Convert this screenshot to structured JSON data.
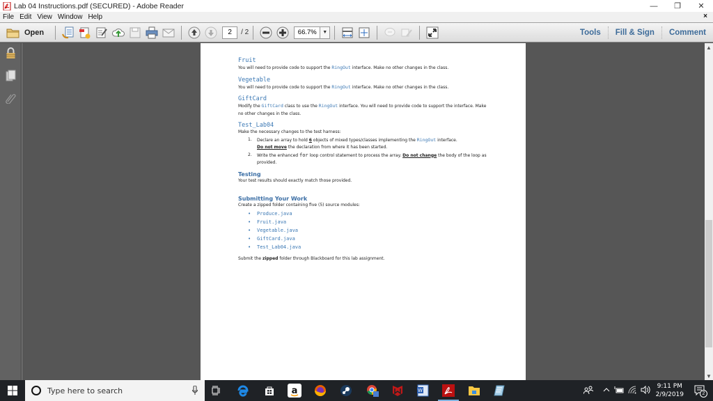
{
  "window": {
    "title": "Lab 04 Instructions.pdf (SECURED) - Adobe Reader",
    "controls": {
      "minimize": "—",
      "restore": "❐",
      "close": "✕"
    }
  },
  "menubar": {
    "items": [
      "File",
      "Edit",
      "View",
      "Window",
      "Help"
    ],
    "doc_close": "×"
  },
  "toolbar": {
    "open_label": "Open",
    "current_page": "2",
    "page_total": "/ 2",
    "zoom": "66.7%",
    "right_tabs": [
      "Tools",
      "Fill & Sign",
      "Comment"
    ]
  },
  "document": {
    "sections": [
      {
        "heading": "Fruit",
        "text_before": "You will need to provide code to support the ",
        "code": "RingOut",
        "text_after": " interface.  Make no other changes in the class."
      },
      {
        "heading": "Vegetable",
        "text_before": "You will need to provide code to support the ",
        "code": "RingOut",
        "text_after": " interface.  Make no other changes in the class."
      }
    ],
    "giftcard": {
      "heading": "GiftCard",
      "t1": "Modify the ",
      "c1": "GiftCard",
      "t2": " class to use the ",
      "c2": "RingOut",
      "t3": " interface. You will need to provide code to support the interface. Make no other changes in the class."
    },
    "test": {
      "heading": "Test_Lab04",
      "intro": "Make the necessary changes to the test harness:",
      "item1": {
        "num": "1.",
        "t1": "Declare an array to hold ",
        "n": "6",
        "t2": " objects of mixed types/classes implementing the ",
        "code": "RingOut",
        "t3": " interface.",
        "u": "Do not move",
        "t4": " the declaration from where it has been started."
      },
      "item2": {
        "num": "2.",
        "t1": "Write the enhanced ",
        "kw": "for",
        "t2": " loop control statement to process the array.  ",
        "u": "Do not change",
        "t3": " the body of the loop as provided."
      }
    },
    "testing": {
      "heading": "Testing",
      "text": "Your test results should exactly match those provided."
    },
    "submit": {
      "heading": "Submitting Your Work",
      "intro": "Create a zipped folder containing five (5) source modules:",
      "files": [
        "Produce.java",
        "Fruit.java",
        "Vegetable.java",
        "GiftCard.java",
        "Test_Lab04.java"
      ],
      "t1": "Submit the ",
      "bold": "zipped",
      "t2": " folder through Blackboard for this lab assignment."
    }
  },
  "scrollbar": {
    "position_fraction": 0.55
  },
  "taskbar": {
    "search_placeholder": "Type here to search",
    "apps": [
      "task-view",
      "edge",
      "store",
      "amazon",
      "firefox",
      "steam",
      "chrome",
      "mcafee",
      "word",
      "adobe-reader",
      "file-explorer",
      "notepad"
    ],
    "time": "9:11 PM",
    "date": "2/9/2019",
    "notifications": "2"
  }
}
